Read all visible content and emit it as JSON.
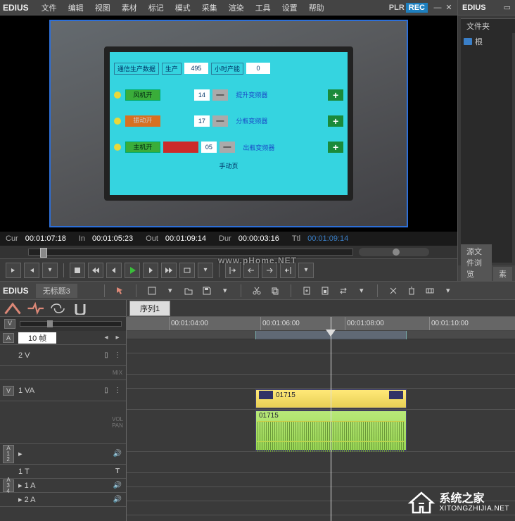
{
  "app": {
    "name": "EDIUS"
  },
  "menu": {
    "file": "文件",
    "edit": "编辑",
    "view": "视图",
    "clip": "素材",
    "marker": "标记",
    "mode": "模式",
    "capture": "采集",
    "render": "渲染",
    "tools": "工具",
    "settings": "设置",
    "help": "帮助"
  },
  "monitor": {
    "mode_plr": "PLR",
    "mode_rec": "REC",
    "watermark": "www.pHome.NET"
  },
  "embedded": {
    "top_left": "通信生产数据",
    "top_field1_label": "生产",
    "top_field1_val": "495",
    "top_field2_label": "小时产能",
    "top_field2_val": "0",
    "btn_fan": "风机开",
    "btn_vib": "振动开",
    "btn_host": "主机开",
    "num1": "14",
    "num2": "17",
    "num3": "05",
    "label1": "提升变频器",
    "label2": "分瓶变频器",
    "label3": "出瓶变频器",
    "footer": "手动页"
  },
  "timecode": {
    "cur_lbl": "Cur",
    "cur_val": "00:01:07:18",
    "in_lbl": "In",
    "in_val": "00:01:05:23",
    "out_lbl": "Out",
    "out_val": "00:01:09:14",
    "dur_lbl": "Dur",
    "dur_val": "00:00:03:16",
    "ttl_lbl": "Ttl",
    "ttl_val": "00:01:09:14"
  },
  "right_panel": {
    "logo": "EDIUS",
    "tab": "文件夹",
    "root": "根",
    "bottom_tab1": "源文件浏览",
    "bottom_tab2": "素"
  },
  "timeline": {
    "project": "无标题3",
    "sequence": "序列1",
    "frames_label": "10 帧",
    "ruler": {
      "t0": "",
      "t1": "00:01:04:00",
      "t2": "00:01:06:00",
      "t3": "00:01:08:00",
      "t4": "00:01:10:00"
    },
    "tracks": {
      "v2": "2 V",
      "va1": "1 VA",
      "a12": "",
      "t1": "1 T",
      "a34": "",
      "a1": "1 A",
      "a2": "2 A",
      "mix": "MIX",
      "volpan": "VOL\nPAN"
    },
    "patches": {
      "v": "V",
      "a": "A",
      "a12": "A\n1\n2",
      "a34": "A\n3\n4"
    },
    "clip": {
      "name": "01715"
    }
  },
  "branding": {
    "cn": "系统之家",
    "url": "XITONGZHIJIA.NET"
  }
}
